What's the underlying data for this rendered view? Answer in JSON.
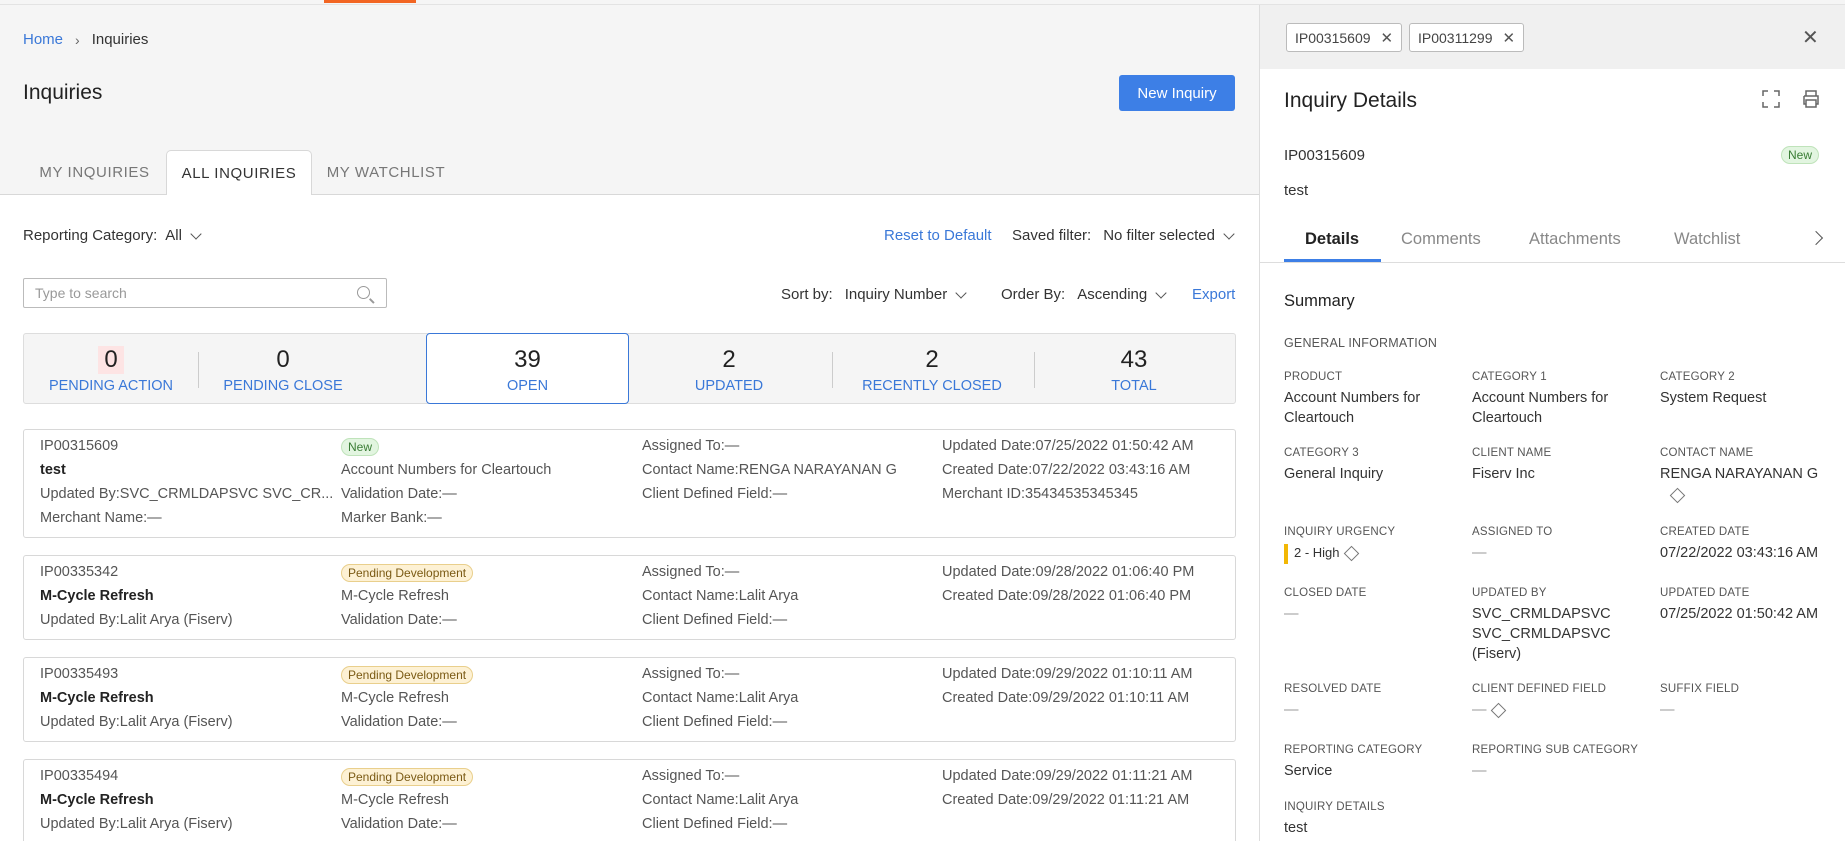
{
  "breadcrumb": {
    "home": "Home",
    "current": "Inquiries"
  },
  "page_title": "Inquiries",
  "new_inquiry_label": "New Inquiry",
  "tabs": [
    {
      "label": "MY INQUIRIES"
    },
    {
      "label": "ALL INQUIRIES"
    },
    {
      "label": "MY WATCHLIST"
    }
  ],
  "filters": {
    "reporting_label": "Reporting Category:",
    "reporting_value": "All",
    "reset_label": "Reset to Default",
    "saved_label": "Saved filter:",
    "saved_value": "No filter selected",
    "search_placeholder": "Type to search",
    "sort_label": "Sort by:",
    "sort_value": "Inquiry Number",
    "order_label": "Order By:",
    "order_value": "Ascending",
    "export_label": "Export"
  },
  "stats": [
    {
      "num": "0",
      "label": "PENDING ACTION"
    },
    {
      "num": "0",
      "label": "PENDING CLOSE"
    },
    {
      "num": "39",
      "label": "OPEN"
    },
    {
      "num": "2",
      "label": "UPDATED"
    },
    {
      "num": "2",
      "label": "RECENTLY CLOSED"
    },
    {
      "num": "43",
      "label": "TOTAL"
    }
  ],
  "cards": [
    {
      "id": "IP00315609",
      "title": "test",
      "updated_by": "Updated By:SVC_CRMLDAPSVC SVC_CR...",
      "merchant_name": "Merchant Name:—",
      "status": "New",
      "category": "Account Numbers for Cleartouch",
      "validation": "Validation Date:—",
      "marker_bank": "Marker Bank:—",
      "assigned": "Assigned To:—",
      "contact": "Contact Name:RENGA NARAYANAN G",
      "client_field": "Client Defined Field:—",
      "updated_date": "Updated Date:07/25/2022 01:50:42 AM",
      "created_date": "Created Date:07/22/2022 03:43:16 AM",
      "merchant_id": "Merchant ID:35434535345345"
    },
    {
      "id": "IP00335342",
      "title": "M-Cycle Refresh",
      "updated_by": "Updated By:Lalit Arya (Fiserv)",
      "status": "Pending Development",
      "category": "M-Cycle Refresh",
      "validation": "Validation Date:—",
      "assigned": "Assigned To:—",
      "contact": "Contact Name:Lalit Arya",
      "client_field": "Client Defined Field:—",
      "updated_date": "Updated Date:09/28/2022 01:06:40 PM",
      "created_date": "Created Date:09/28/2022 01:06:40 PM"
    },
    {
      "id": "IP00335493",
      "title": "M-Cycle Refresh",
      "updated_by": "Updated By:Lalit Arya (Fiserv)",
      "status": "Pending Development",
      "category": "M-Cycle Refresh",
      "validation": "Validation Date:—",
      "assigned": "Assigned To:—",
      "contact": "Contact Name:Lalit Arya",
      "client_field": "Client Defined Field:—",
      "updated_date": "Updated Date:09/29/2022 01:10:11 AM",
      "created_date": "Created Date:09/29/2022 01:10:11 AM"
    },
    {
      "id": "IP00335494",
      "title": "M-Cycle Refresh",
      "updated_by": "Updated By:Lalit Arya (Fiserv)",
      "status": "Pending Development",
      "category": "M-Cycle Refresh",
      "validation": "Validation Date:—",
      "assigned": "Assigned To:—",
      "contact": "Contact Name:Lalit Arya",
      "client_field": "Client Defined Field:—",
      "updated_date": "Updated Date:09/29/2022 01:11:21 AM",
      "created_date": "Created Date:09/29/2022 01:11:21 AM"
    }
  ],
  "panel": {
    "chips": [
      "IP00315609",
      "IP00311299"
    ],
    "title": "Inquiry Details",
    "id": "IP00315609",
    "status": "New",
    "subject": "test",
    "tabs": [
      "Details",
      "Comments",
      "Attachments",
      "Watchlist"
    ],
    "summary": "Summary",
    "general": "GENERAL INFORMATION",
    "fields": {
      "product": {
        "k": "PRODUCT",
        "v": "Account Numbers for Cleartouch"
      },
      "cat1": {
        "k": "CATEGORY 1",
        "v": "Account Numbers for Cleartouch"
      },
      "cat2": {
        "k": "CATEGORY 2",
        "v": "System Request"
      },
      "cat3": {
        "k": "CATEGORY 3",
        "v": "General Inquiry"
      },
      "client": {
        "k": "CLIENT NAME",
        "v": "Fiserv Inc"
      },
      "contact": {
        "k": "CONTACT NAME",
        "v": "RENGA NARAYANAN G"
      },
      "urgency": {
        "k": "INQUIRY URGENCY",
        "v": "2 - High"
      },
      "assigned": {
        "k": "ASSIGNED TO",
        "v": "—"
      },
      "created": {
        "k": "CREATED DATE",
        "v": "07/22/2022 03:43:16 AM"
      },
      "closed": {
        "k": "CLOSED DATE",
        "v": "—"
      },
      "updated_by": {
        "k": "UPDATED BY",
        "v": "SVC_CRMLDAPSVC SVC_CRMLDAPSVC (Fiserv)"
      },
      "updated": {
        "k": "UPDATED DATE",
        "v": "07/25/2022 01:50:42 AM"
      },
      "resolved": {
        "k": "RESOLVED DATE",
        "v": "—"
      },
      "client_field": {
        "k": "CLIENT DEFINED FIELD",
        "v": "—"
      },
      "suffix": {
        "k": "SUFFIX FIELD",
        "v": "—"
      },
      "reporting": {
        "k": "REPORTING CATEGORY",
        "v": "Service"
      },
      "reporting_sub": {
        "k": "REPORTING SUB CATEGORY",
        "v": "—"
      },
      "details": {
        "k": "INQUIRY DETAILS",
        "v": "test"
      }
    }
  },
  "colors": {
    "accent": "#3d7fe6",
    "brand_top": "#f26522",
    "urgency_high": "#f2b705"
  }
}
